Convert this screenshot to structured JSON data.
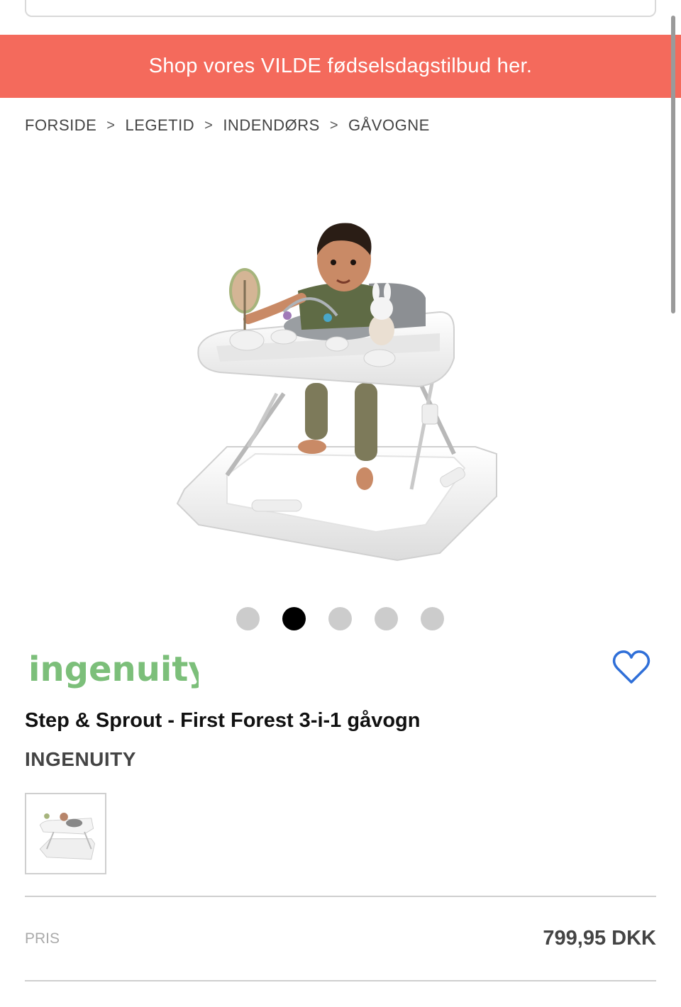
{
  "promo": {
    "text": "Shop vores VILDE fødselsdagstilbud her."
  },
  "breadcrumb": {
    "separator": ">",
    "items": [
      "FORSIDE",
      "LEGETID",
      "INDENDØRS",
      "GÅVOGNE"
    ]
  },
  "carousel": {
    "count": 5,
    "active_index": 1
  },
  "brand_logo_text": "ingenuity",
  "product": {
    "title": "Step & Sprout - First Forest 3-i-1 gåvogn",
    "brand": "INGENUITY",
    "price_label": "PRIS",
    "price": "799,95 DKK"
  },
  "colors": {
    "banner": "#f46a5c",
    "logo_green": "#7cbf7a",
    "heart_blue": "#2f6fd8"
  },
  "icons": {
    "favorite": "heart-icon"
  }
}
